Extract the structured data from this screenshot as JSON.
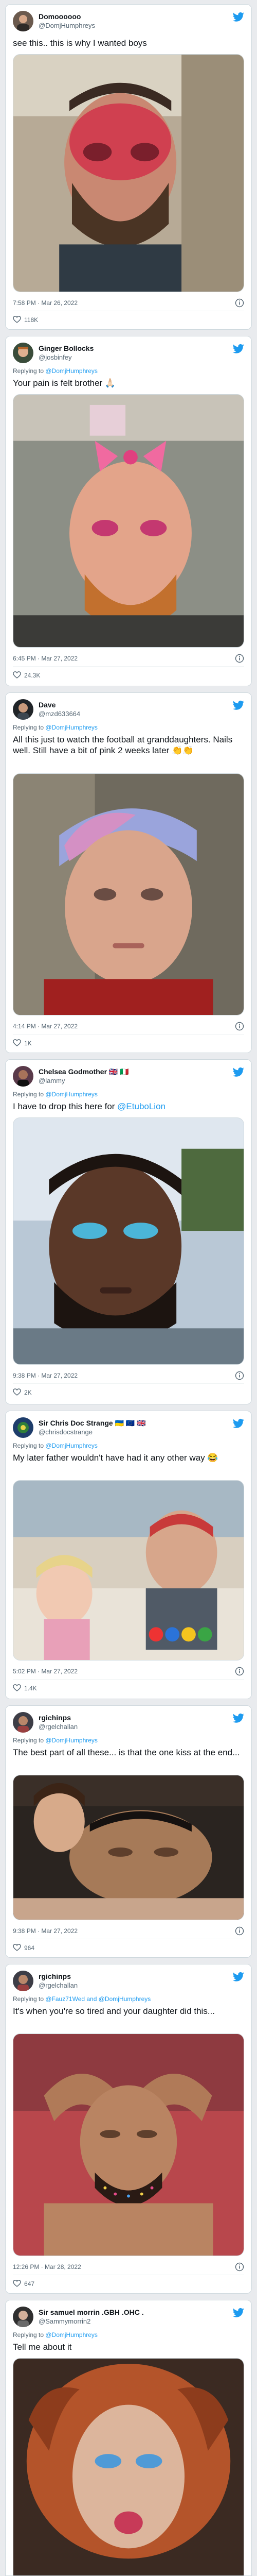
{
  "colors": {
    "accent": "#1d9bf0",
    "text": "#0f1419",
    "muted": "#536471",
    "border": "#cfd9de"
  },
  "icons": {
    "brand": "twitter-bird-icon",
    "info": "info-icon",
    "like": "heart-icon"
  },
  "tweets": [
    {
      "name": "Domoooooo",
      "handle": "@DomjHumphreys",
      "reply_prefix": "",
      "reply_to": "",
      "text": "see this.. this is why I wanted boys",
      "link": "",
      "timestamp": "7:58 PM · Mar 26, 2022",
      "likes": "118K"
    },
    {
      "name": "Ginger Bollocks",
      "handle": "@josbinfey",
      "reply_prefix": "Replying to ",
      "reply_to": "@DomjHumphreys",
      "text": "Your pain is felt brother 🙏🏻",
      "link": "",
      "timestamp": "6:45 PM · Mar 27, 2022",
      "likes": "24.3K"
    },
    {
      "name": "Dave",
      "handle": "@mzd633664",
      "reply_prefix": "Replying to ",
      "reply_to": "@DomjHumphreys",
      "text": "All this just to watch the football at granddaughters. Nails well. Still have a bit of pink 2 weeks later 👏👏",
      "link": "",
      "timestamp": "4:14 PM · Mar 27, 2022",
      "likes": "1K"
    },
    {
      "name": "Chelsea Godmother 🇬🇧 🇮🇹",
      "handle": "@lammy",
      "reply_prefix": "Replying to ",
      "reply_to": "@DomjHumphreys",
      "text": "I have to drop this here for ",
      "link": "@EtuboLion",
      "timestamp": "9:38 PM · Mar 27, 2022",
      "likes": "2K"
    },
    {
      "name": "Sir Chris Doc Strange 🇺🇦 🇪🇺 🇬🇧",
      "handle": "@chrisdocstrange",
      "reply_prefix": "Replying to ",
      "reply_to": "@DomjHumphreys",
      "text": "My later father wouldn't have had it any other way 😂",
      "link": "",
      "timestamp": "5:02 PM · Mar 27, 2022",
      "likes": "1.4K"
    },
    {
      "name": "rgichinps",
      "handle": "@rgelchallan",
      "reply_prefix": "Replying to ",
      "reply_to": "@DomjHumphreys",
      "text": "The best part of all these... is that the one kiss at the end...",
      "link": "",
      "timestamp": "9:38 PM · Mar 27, 2022",
      "likes": "964"
    },
    {
      "name": "rgichinps",
      "handle": "@rgelchallan",
      "reply_prefix": "Replying to ",
      "reply_to": "@Fauz71Wed and @DomjHumphreys",
      "text": "It's when you're so tired and your daughter did this...",
      "link": "",
      "timestamp": "12:26 PM · Mar 28, 2022",
      "likes": "647"
    },
    {
      "name": "Sir samuel morrin .GBH .OHC .",
      "handle": "@Sammymorrin2",
      "reply_prefix": "Replying to ",
      "reply_to": "@DomjHumphreys",
      "text": "Tell me about it",
      "link": "",
      "timestamp": "",
      "likes": ""
    }
  ]
}
